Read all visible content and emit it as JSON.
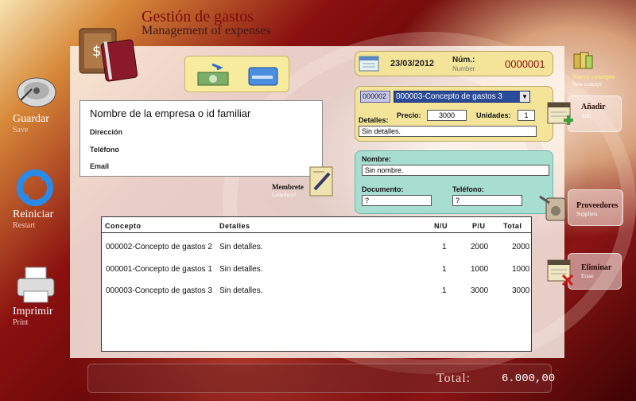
{
  "header": {
    "title": "Gestión de gastos",
    "subtitle": "Management of expenses"
  },
  "sidebar": [
    {
      "label": "Guardar",
      "sub": "Save",
      "icon": "hard-drive-icon"
    },
    {
      "label": "Reiniciar",
      "sub": "Restart",
      "icon": "refresh-icon"
    },
    {
      "label": "Imprimir",
      "sub": "Print",
      "icon": "printer-icon"
    }
  ],
  "company": {
    "name": "Nombre de la empresa o id familiar",
    "address_label": "Dirección",
    "phone_label": "Teléfono",
    "email_label": "Email"
  },
  "letterhead": {
    "label": "Membrete",
    "sub": "Letterhead"
  },
  "document": {
    "date": "23/03/2012",
    "num_label": "Núm.:",
    "num_sub": "Number",
    "number": "0000001"
  },
  "concept": {
    "code": "000002",
    "selected": "000003-Concepto de gastos 3",
    "details_label": "Detalles:",
    "price_label": "Precio:",
    "price": "3000",
    "units_label": "Unidades:",
    "units": "1",
    "details": "Sin detalles."
  },
  "supplier": {
    "name_label": "Nombre:",
    "name": "Sin nombre.",
    "doc_label": "Documento:",
    "doc": "?",
    "phone_label": "Teléfono:",
    "phone": "?"
  },
  "actions": {
    "new_concept": "Nuevo concepto",
    "new_concept_sub": "New concept",
    "add": "Añadir",
    "add_sub": "Add",
    "suppliers": "Proveedores",
    "suppliers_sub": "Suppliers",
    "erase": "Eliminar",
    "erase_sub": "Erase"
  },
  "table": {
    "headers": [
      "Concepto",
      "Detalles",
      "N/U",
      "P/U",
      "Total"
    ],
    "rows": [
      [
        "000002-Concepto de gastos 2",
        "Sin detalles.",
        "1",
        "2000",
        "2000"
      ],
      [
        "000001-Concepto de gastos 1",
        "Sin detalles.",
        "1",
        "1000",
        "1000"
      ],
      [
        "000003-Concepto de gastos 3",
        "Sin detalles.",
        "1",
        "3000",
        "3000"
      ]
    ]
  },
  "total": {
    "label": "Total:",
    "value": "6.000,00"
  }
}
